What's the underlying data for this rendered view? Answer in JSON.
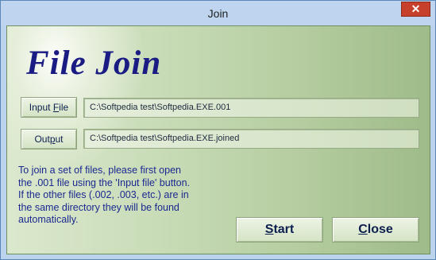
{
  "window": {
    "title": "Join",
    "close_glyph": "✕"
  },
  "app_title": "File Join",
  "input_file": {
    "button_pre": "Input ",
    "button_accel": "F",
    "button_post": "ile",
    "path": "C:\\Softpedia test\\Softpedia.EXE.001"
  },
  "output": {
    "button_pre": "Out",
    "button_accel": "p",
    "button_post": "ut",
    "path": "C:\\Softpedia test\\Softpedia.EXE.joined"
  },
  "help_lines": [
    "To join a set of files, please first open",
    "the .001 file using the 'Input file' button.",
    "If the other files (.002, .003, etc.) are in",
    "the same directory they will be found",
    "automatically."
  ],
  "start": {
    "accel": "S",
    "rest": "tart"
  },
  "close": {
    "accel": "C",
    "rest": "lose"
  }
}
